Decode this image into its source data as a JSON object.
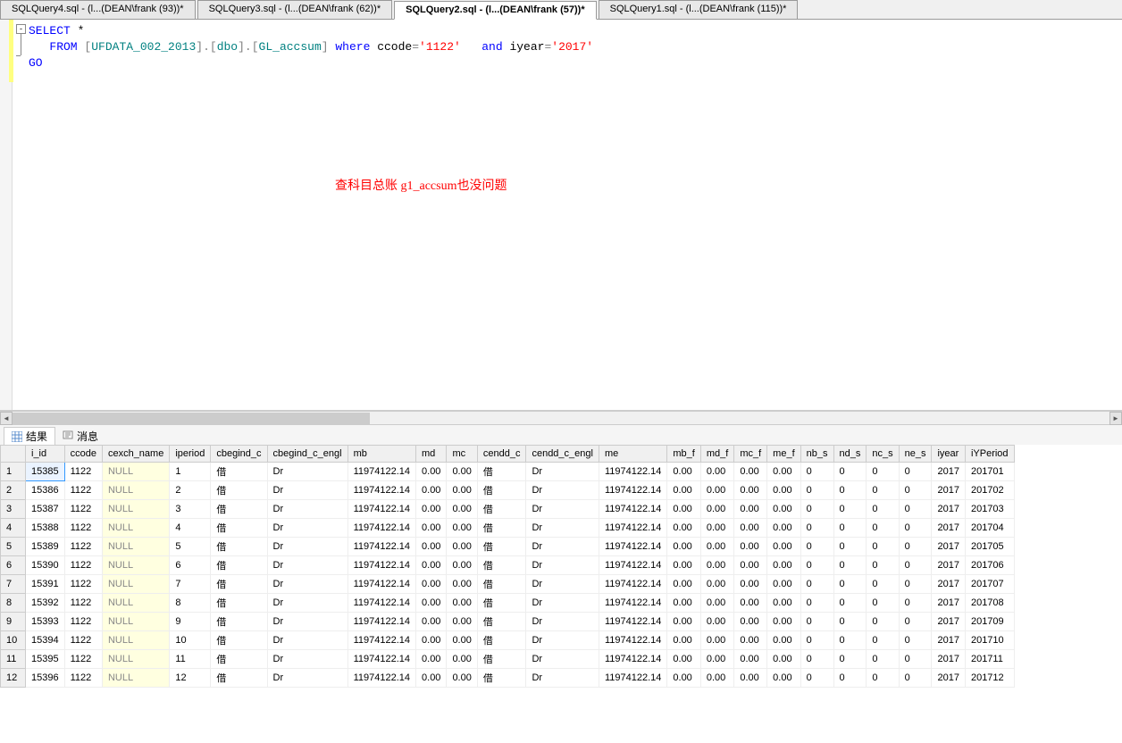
{
  "tabs": [
    {
      "label": "SQLQuery4.sql - (l...(DEAN\\frank (93))*"
    },
    {
      "label": "SQLQuery3.sql - (l...(DEAN\\frank (62))*"
    },
    {
      "label": "SQLQuery2.sql - (l...(DEAN\\frank (57))*",
      "active": true
    },
    {
      "label": "SQLQuery1.sql - (l...(DEAN\\frank (115))*"
    }
  ],
  "fold_symbol": "-",
  "sql": {
    "select_kw": "SELECT",
    "star": " *",
    "from_kw": "FROM",
    "obj_open1": " [",
    "obj1": "UFDATA_002_2013",
    "obj_close1": "]",
    "dot1": ".",
    "obj_open2": "[",
    "obj2": "dbo",
    "obj_close2": "]",
    "dot2": ".",
    "obj_open3": "[",
    "obj3": "GL_accsum",
    "obj_close3": "]",
    "where_kw": " where",
    "col1": " ccode",
    "eq1": "=",
    "val1": "'1122'",
    "and_kw": "and",
    "col2": " iyear",
    "eq2": "=",
    "val2": "'2017'",
    "go": "GO"
  },
  "annotation": "查科目总账 g1_accsum也没问题",
  "result_tabs": {
    "results": "结果",
    "messages": "消息"
  },
  "columns": [
    "i_id",
    "ccode",
    "cexch_name",
    "iperiod",
    "cbegind_c",
    "cbegind_c_engl",
    "mb",
    "md",
    "mc",
    "cendd_c",
    "cendd_c_engl",
    "me",
    "mb_f",
    "md_f",
    "mc_f",
    "me_f",
    "nb_s",
    "nd_s",
    "nc_s",
    "ne_s",
    "iyear",
    "iYPeriod"
  ],
  "null_text": "NULL",
  "rows": [
    {
      "n": 1,
      "i_id": "15385",
      "ccode": "1122",
      "iperiod": "1",
      "cbegind_c": "借",
      "cbegind_c_engl": "Dr",
      "mb": "11974122.14",
      "md": "0.00",
      "mc": "0.00",
      "cendd_c": "借",
      "cendd_c_engl": "Dr",
      "me": "11974122.14",
      "mb_f": "0.00",
      "md_f": "0.00",
      "mc_f": "0.00",
      "me_f": "0.00",
      "nb_s": "0",
      "nd_s": "0",
      "nc_s": "0",
      "ne_s": "0",
      "iyear": "2017",
      "iYPeriod": "201701"
    },
    {
      "n": 2,
      "i_id": "15386",
      "ccode": "1122",
      "iperiod": "2",
      "cbegind_c": "借",
      "cbegind_c_engl": "Dr",
      "mb": "11974122.14",
      "md": "0.00",
      "mc": "0.00",
      "cendd_c": "借",
      "cendd_c_engl": "Dr",
      "me": "11974122.14",
      "mb_f": "0.00",
      "md_f": "0.00",
      "mc_f": "0.00",
      "me_f": "0.00",
      "nb_s": "0",
      "nd_s": "0",
      "nc_s": "0",
      "ne_s": "0",
      "iyear": "2017",
      "iYPeriod": "201702"
    },
    {
      "n": 3,
      "i_id": "15387",
      "ccode": "1122",
      "iperiod": "3",
      "cbegind_c": "借",
      "cbegind_c_engl": "Dr",
      "mb": "11974122.14",
      "md": "0.00",
      "mc": "0.00",
      "cendd_c": "借",
      "cendd_c_engl": "Dr",
      "me": "11974122.14",
      "mb_f": "0.00",
      "md_f": "0.00",
      "mc_f": "0.00",
      "me_f": "0.00",
      "nb_s": "0",
      "nd_s": "0",
      "nc_s": "0",
      "ne_s": "0",
      "iyear": "2017",
      "iYPeriod": "201703"
    },
    {
      "n": 4,
      "i_id": "15388",
      "ccode": "1122",
      "iperiod": "4",
      "cbegind_c": "借",
      "cbegind_c_engl": "Dr",
      "mb": "11974122.14",
      "md": "0.00",
      "mc": "0.00",
      "cendd_c": "借",
      "cendd_c_engl": "Dr",
      "me": "11974122.14",
      "mb_f": "0.00",
      "md_f": "0.00",
      "mc_f": "0.00",
      "me_f": "0.00",
      "nb_s": "0",
      "nd_s": "0",
      "nc_s": "0",
      "ne_s": "0",
      "iyear": "2017",
      "iYPeriod": "201704"
    },
    {
      "n": 5,
      "i_id": "15389",
      "ccode": "1122",
      "iperiod": "5",
      "cbegind_c": "借",
      "cbegind_c_engl": "Dr",
      "mb": "11974122.14",
      "md": "0.00",
      "mc": "0.00",
      "cendd_c": "借",
      "cendd_c_engl": "Dr",
      "me": "11974122.14",
      "mb_f": "0.00",
      "md_f": "0.00",
      "mc_f": "0.00",
      "me_f": "0.00",
      "nb_s": "0",
      "nd_s": "0",
      "nc_s": "0",
      "ne_s": "0",
      "iyear": "2017",
      "iYPeriod": "201705"
    },
    {
      "n": 6,
      "i_id": "15390",
      "ccode": "1122",
      "iperiod": "6",
      "cbegind_c": "借",
      "cbegind_c_engl": "Dr",
      "mb": "11974122.14",
      "md": "0.00",
      "mc": "0.00",
      "cendd_c": "借",
      "cendd_c_engl": "Dr",
      "me": "11974122.14",
      "mb_f": "0.00",
      "md_f": "0.00",
      "mc_f": "0.00",
      "me_f": "0.00",
      "nb_s": "0",
      "nd_s": "0",
      "nc_s": "0",
      "ne_s": "0",
      "iyear": "2017",
      "iYPeriod": "201706"
    },
    {
      "n": 7,
      "i_id": "15391",
      "ccode": "1122",
      "iperiod": "7",
      "cbegind_c": "借",
      "cbegind_c_engl": "Dr",
      "mb": "11974122.14",
      "md": "0.00",
      "mc": "0.00",
      "cendd_c": "借",
      "cendd_c_engl": "Dr",
      "me": "11974122.14",
      "mb_f": "0.00",
      "md_f": "0.00",
      "mc_f": "0.00",
      "me_f": "0.00",
      "nb_s": "0",
      "nd_s": "0",
      "nc_s": "0",
      "ne_s": "0",
      "iyear": "2017",
      "iYPeriod": "201707"
    },
    {
      "n": 8,
      "i_id": "15392",
      "ccode": "1122",
      "iperiod": "8",
      "cbegind_c": "借",
      "cbegind_c_engl": "Dr",
      "mb": "11974122.14",
      "md": "0.00",
      "mc": "0.00",
      "cendd_c": "借",
      "cendd_c_engl": "Dr",
      "me": "11974122.14",
      "mb_f": "0.00",
      "md_f": "0.00",
      "mc_f": "0.00",
      "me_f": "0.00",
      "nb_s": "0",
      "nd_s": "0",
      "nc_s": "0",
      "ne_s": "0",
      "iyear": "2017",
      "iYPeriod": "201708"
    },
    {
      "n": 9,
      "i_id": "15393",
      "ccode": "1122",
      "iperiod": "9",
      "cbegind_c": "借",
      "cbegind_c_engl": "Dr",
      "mb": "11974122.14",
      "md": "0.00",
      "mc": "0.00",
      "cendd_c": "借",
      "cendd_c_engl": "Dr",
      "me": "11974122.14",
      "mb_f": "0.00",
      "md_f": "0.00",
      "mc_f": "0.00",
      "me_f": "0.00",
      "nb_s": "0",
      "nd_s": "0",
      "nc_s": "0",
      "ne_s": "0",
      "iyear": "2017",
      "iYPeriod": "201709"
    },
    {
      "n": 10,
      "i_id": "15394",
      "ccode": "1122",
      "iperiod": "10",
      "cbegind_c": "借",
      "cbegind_c_engl": "Dr",
      "mb": "11974122.14",
      "md": "0.00",
      "mc": "0.00",
      "cendd_c": "借",
      "cendd_c_engl": "Dr",
      "me": "11974122.14",
      "mb_f": "0.00",
      "md_f": "0.00",
      "mc_f": "0.00",
      "me_f": "0.00",
      "nb_s": "0",
      "nd_s": "0",
      "nc_s": "0",
      "ne_s": "0",
      "iyear": "2017",
      "iYPeriod": "201710"
    },
    {
      "n": 11,
      "i_id": "15395",
      "ccode": "1122",
      "iperiod": "11",
      "cbegind_c": "借",
      "cbegind_c_engl": "Dr",
      "mb": "11974122.14",
      "md": "0.00",
      "mc": "0.00",
      "cendd_c": "借",
      "cendd_c_engl": "Dr",
      "me": "11974122.14",
      "mb_f": "0.00",
      "md_f": "0.00",
      "mc_f": "0.00",
      "me_f": "0.00",
      "nb_s": "0",
      "nd_s": "0",
      "nc_s": "0",
      "ne_s": "0",
      "iyear": "2017",
      "iYPeriod": "201711"
    },
    {
      "n": 12,
      "i_id": "15396",
      "ccode": "1122",
      "iperiod": "12",
      "cbegind_c": "借",
      "cbegind_c_engl": "Dr",
      "mb": "11974122.14",
      "md": "0.00",
      "mc": "0.00",
      "cendd_c": "借",
      "cendd_c_engl": "Dr",
      "me": "11974122.14",
      "mb_f": "0.00",
      "md_f": "0.00",
      "mc_f": "0.00",
      "me_f": "0.00",
      "nb_s": "0",
      "nd_s": "0",
      "nc_s": "0",
      "ne_s": "0",
      "iyear": "2017",
      "iYPeriod": "201712"
    }
  ]
}
